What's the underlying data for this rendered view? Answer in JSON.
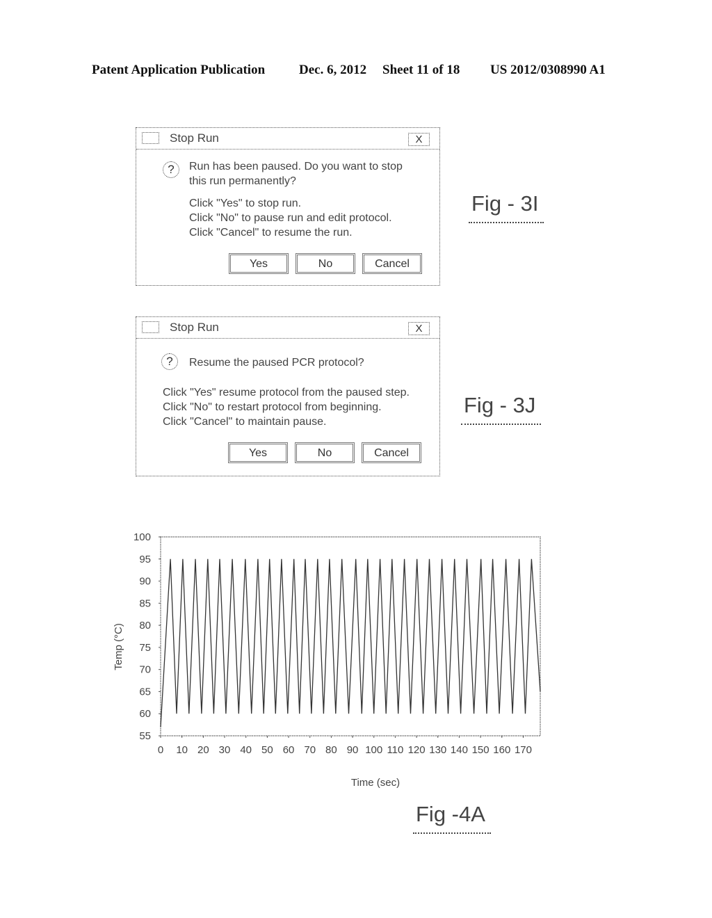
{
  "header": {
    "publication": "Patent Application Publication",
    "date": "Dec. 6, 2012",
    "sheet": "Sheet 11 of 18",
    "number": "US 2012/0308990 A1"
  },
  "dialogs": [
    {
      "figure": "Fig - 3I",
      "title": "Stop Run",
      "close_label": "X",
      "icon": "question-icon",
      "question_lines": [
        "Run has been paused. Do you want to stop",
        "this run permanently?"
      ],
      "instructions": [
        "Click \"Yes\" to stop run.",
        "Click \"No\" to pause run and edit protocol.",
        "Click \"Cancel\" to resume the run."
      ],
      "buttons": [
        "Yes",
        "No",
        "Cancel"
      ]
    },
    {
      "figure": "Fig - 3J",
      "title": "Stop Run",
      "close_label": "X",
      "icon": "question-icon",
      "question_lines": [
        "Resume the paused PCR protocol?"
      ],
      "instructions": [
        "Click \"Yes\" resume protocol from the paused step.",
        "Click \"No\" to restart protocol from beginning.",
        "Click \"Cancel\" to maintain pause."
      ],
      "buttons": [
        "Yes",
        "No",
        "Cancel"
      ]
    }
  ],
  "chart_data": {
    "type": "line",
    "figure": "Fig -4A",
    "title": "",
    "xlabel": "Time (sec)",
    "ylabel": "Temp (°C)",
    "xlim": [
      0,
      178
    ],
    "ylim": [
      55,
      100
    ],
    "xticks": [
      0,
      10,
      20,
      30,
      40,
      50,
      60,
      70,
      80,
      90,
      100,
      110,
      120,
      130,
      140,
      150,
      160,
      170
    ],
    "yticks": [
      55,
      60,
      65,
      70,
      75,
      80,
      85,
      90,
      95,
      100
    ],
    "grid": false,
    "legend": "none",
    "series": [
      {
        "name": "Temp",
        "x": [
          0,
          4.6,
          7.5,
          10.4,
          13.3,
          16.3,
          19.2,
          22.1,
          24.9,
          27.7,
          30.6,
          33.6,
          36.6,
          39.7,
          42.6,
          45.6,
          48.3,
          51.1,
          53.9,
          56.7,
          59.6,
          62.5,
          65.1,
          67.8,
          70.7,
          73.6,
          76.4,
          79.2,
          82.1,
          85.0,
          88.2,
          91.5,
          94.3,
          97.1,
          100.0,
          102.9,
          105.7,
          108.5,
          111.4,
          114.3,
          117.2,
          120.2,
          123.1,
          126.0,
          129.0,
          131.9,
          134.8,
          137.8,
          140.7,
          143.6,
          146.9,
          150.2,
          152.9,
          155.7,
          158.8,
          161.9,
          165.0,
          168.1,
          171.0,
          173.9,
          178.0
        ],
        "y": [
          57,
          95,
          60,
          95,
          60,
          95,
          60,
          95,
          60,
          95,
          60,
          95,
          60,
          95,
          60,
          95,
          60,
          95,
          60,
          95,
          60,
          95,
          60,
          95,
          60,
          95,
          60,
          95,
          60,
          95,
          60,
          95,
          60,
          95,
          60,
          95,
          60,
          95,
          60,
          95,
          60,
          95,
          60,
          95,
          60,
          95,
          60,
          95,
          60,
          95,
          60,
          95,
          60,
          95,
          60,
          95,
          60,
          95,
          60,
          95,
          65
        ]
      }
    ]
  }
}
